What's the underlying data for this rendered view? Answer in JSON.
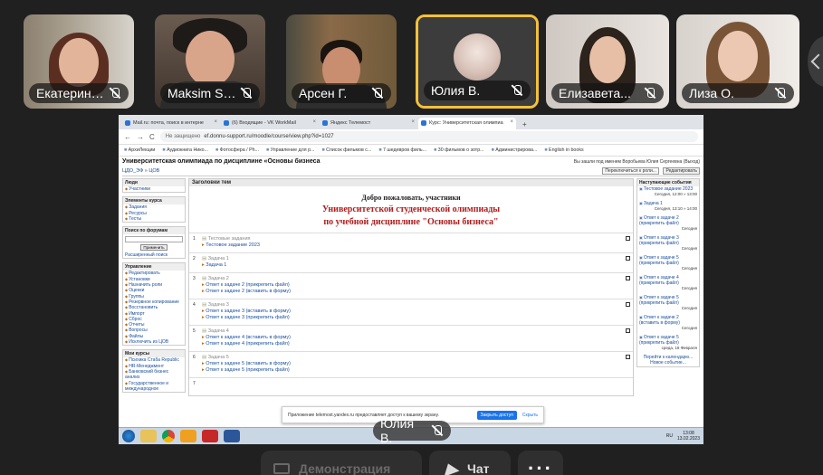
{
  "participants": [
    {
      "name": "Екатерина...",
      "muted": true,
      "active": false
    },
    {
      "name": "Maksim Sh...",
      "muted": true,
      "active": false
    },
    {
      "name": "Арсен Г.",
      "muted": true,
      "active": false
    },
    {
      "name": "Юлия В.",
      "muted": true,
      "active": true
    },
    {
      "name": "Елизавета...",
      "muted": true,
      "active": false
    },
    {
      "name": "Лиза О.",
      "muted": true,
      "active": false
    }
  ],
  "shared_screen": {
    "presenter_name": "Юлия В.",
    "browser": {
      "tabs": [
        {
          "title": "Mail.ru: почта, поиск в интерне",
          "active": false
        },
        {
          "title": "(6) Входящие - VK WorkMail",
          "active": false
        },
        {
          "title": "Яндекс Телемост",
          "active": false
        },
        {
          "title": "Курс: Университетская олимпиа",
          "active": true
        }
      ],
      "new_tab": "+",
      "nav": {
        "back": "←",
        "forward": "→",
        "reload": "C"
      },
      "address": {
        "security": "Не защищено",
        "url": "ef.donnu-support.ru/moodle/course/view.php?id=1027"
      },
      "bookmarks": [
        "АрхиЛекции",
        "Аудиокнига Нико...",
        "Фотосфера / Ph...",
        "Управление для р...",
        "Список фильмов с...",
        "7 шедевров филь...",
        "30 фильмов о зотр...",
        "Администрирова...",
        "English in books"
      ]
    },
    "moodle": {
      "course_title": "Университетская олимпиада по дисциплине «Основы бизнеса",
      "login_info": "Вы зашли под именем Воробьева Юлия Сергеевна (Выход)",
      "breadcrumb": "ЦДО_ЭФ » ЦОВ",
      "switch_role": "Переключиться к роли...",
      "edit_button": "Редактировать",
      "left_blocks": [
        {
          "title": "Люди",
          "items": [
            "Участники"
          ]
        },
        {
          "title": "Элементы курса",
          "items": [
            "Задания",
            "Ресурсы",
            "Тесты"
          ]
        },
        {
          "title": "Поиск по форумам",
          "items": [
            "Расширенный поиск"
          ],
          "search_button": "Применить"
        },
        {
          "title": "Управление",
          "items": [
            "Редактировать",
            "Установки",
            "Назначить роли",
            "Оценки",
            "Группы",
            "Резервное копирование",
            "Восстановить",
            "Импорт",
            "Сброс",
            "Отчеты",
            "Вопросы",
            "Файлы",
            "Исключить из ЦОВ"
          ]
        },
        {
          "title": "Мои курсы",
          "items": [
            "Психика Стаба Republic",
            "HR-Менеджмент",
            "Банковский бизнес анализ",
            "Государственное и международное"
          ]
        }
      ],
      "center_header": "Заголовки тем",
      "welcome": {
        "line1": "Добро пожаловать, участники",
        "line2": "Университетской студенческой олимпиады",
        "line3": "по учебной дисциплине \"Основы бизнеса\""
      },
      "topics": [
        {
          "num": "1",
          "title": "Тестовые задания",
          "links": [
            "Тестовое задание 2023"
          ]
        },
        {
          "num": "2",
          "title": "Задача 1",
          "links": [
            "Задача 1"
          ]
        },
        {
          "num": "3",
          "title": "Задача 2",
          "links": [
            "Ответ к задаче 2 (прикрепить файл)",
            "Ответ к задаче 2 (вставить в форму)"
          ]
        },
        {
          "num": "4",
          "title": "Задача 3",
          "links": [
            "Ответ к задаче 3 (вставить в форму)",
            "Ответ к задаче 3 (прикрепить файл)"
          ]
        },
        {
          "num": "5",
          "title": "Задача 4",
          "links": [
            "Ответ к задаче 4 (вставить в форму)",
            "Ответ к задаче 4 (прикрепить файл)"
          ]
        },
        {
          "num": "6",
          "title": "Задача 5",
          "links": [
            "Ответ к задаче 5 (вставить в форму)",
            "Ответ к задаче 5 (прикрепить файл)"
          ]
        },
        {
          "num": "7",
          "title": "",
          "links": []
        }
      ],
      "right_header": "Наступающие события",
      "events": [
        {
          "title": "Тестовое задание 2023",
          "date": "Сегодня, 12:00 » 13:00"
        },
        {
          "title": "Задача 1",
          "date": "Сегодня, 13:10 » 14:00"
        },
        {
          "title": "Ответ к задаче 2 (прикрепить файл)",
          "date": "Сегодня"
        },
        {
          "title": "Ответ к задаче 3 (прикрепить файл)",
          "date": "Сегодня"
        },
        {
          "title": "Ответ к задаче 5 (прикрепить файл)",
          "date": "Сегодня"
        },
        {
          "title": "Ответ к задаче 4 (прикрепить файл)",
          "date": "Сегодня"
        },
        {
          "title": "Ответ к задаче 5 (прикрепить файл)",
          "date": "Сегодня"
        },
        {
          "title": "Ответ к задаче 2 (вставить в форму)",
          "date": "Сегодня"
        },
        {
          "title": "Ответ к задаче 5 (прикрепить файл)",
          "date": "среда, 18 Февраля"
        }
      ],
      "events_footer": [
        "Перейти к календарю...",
        "Новое событие..."
      ]
    },
    "notification": {
      "text": "Приложение telemost.yandex.ru предоставляет доступ к вашему экрану.",
      "stop_button": "Закрыть доступ",
      "hide_link": "Скрыть"
    },
    "taskbar": {
      "lang": "RU",
      "time": "13:08",
      "date": "13.02.2023"
    }
  },
  "controls": [
    {
      "label": "Демонстрация",
      "icon": "screen-share-icon",
      "dim": true
    },
    {
      "label": "Чат",
      "icon": "chat-icon",
      "dim": false
    },
    {
      "label": "···",
      "icon": "more-icon",
      "dim": false
    }
  ]
}
